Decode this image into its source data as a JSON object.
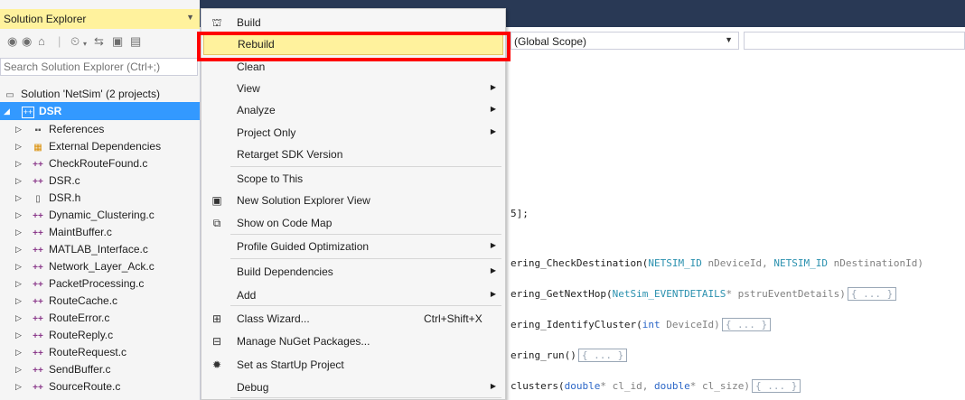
{
  "solution_explorer": {
    "title": "Solution Explorer",
    "search_placeholder": "Search Solution Explorer (Ctrl+;)",
    "solution_label": "Solution 'NetSim' (2 projects)",
    "project_label": "DSR",
    "items": [
      {
        "label": "References",
        "icon": "references-icon"
      },
      {
        "label": "External Dependencies",
        "icon": "external-dependencies-icon"
      },
      {
        "label": "CheckRouteFound.c",
        "icon": "c-file-icon"
      },
      {
        "label": "DSR.c",
        "icon": "c-file-icon"
      },
      {
        "label": "DSR.h",
        "icon": "h-file-icon"
      },
      {
        "label": "Dynamic_Clustering.c",
        "icon": "c-file-icon"
      },
      {
        "label": "MaintBuffer.c",
        "icon": "c-file-icon"
      },
      {
        "label": "MATLAB_Interface.c",
        "icon": "c-file-icon"
      },
      {
        "label": "Network_Layer_Ack.c",
        "icon": "c-file-icon"
      },
      {
        "label": "PacketProcessing.c",
        "icon": "c-file-icon"
      },
      {
        "label": "RouteCache.c",
        "icon": "c-file-icon"
      },
      {
        "label": "RouteError.c",
        "icon": "c-file-icon"
      },
      {
        "label": "RouteReply.c",
        "icon": "c-file-icon"
      },
      {
        "label": "RouteRequest.c",
        "icon": "c-file-icon"
      },
      {
        "label": "SendBuffer.c",
        "icon": "c-file-icon"
      },
      {
        "label": "SourceRoute.c",
        "icon": "c-file-icon"
      }
    ]
  },
  "editor": {
    "scope": "(Global Scope)",
    "lines": [
      {
        "text": "5];"
      },
      {
        "pre": "ering_CheckDestination(",
        "t1": "NETSIM_ID",
        "a1": " nDeviceId, ",
        "t2": "NETSIM_ID",
        "a2": " nDestinationId)"
      },
      {
        "pre": "ering_GetNextHop(",
        "t1": "NetSim_EVENTDETAILS",
        "a1": "* pstruEventDetails)",
        "fold": "{ ... }"
      },
      {
        "pre": "ering_IdentifyCluster(",
        "t1": "int",
        "a1": " DeviceId)",
        "fold": "{ ... }"
      },
      {
        "pre": "ering_run()",
        "fold": "{ ... }"
      },
      {
        "pre": "clusters(",
        "t1": "double",
        "a1": "* cl_id, ",
        "t2": "double",
        "a2": "* cl_size)",
        "fold": "{ ... }"
      }
    ]
  },
  "context_menu": {
    "items": [
      {
        "label": "Build",
        "icon": "build-icon"
      },
      {
        "label": "Rebuild",
        "highlighted": true
      },
      {
        "label": "Clean"
      },
      {
        "label": "View",
        "submenu": true
      },
      {
        "label": "Analyze",
        "submenu": true
      },
      {
        "label": "Project Only",
        "submenu": true
      },
      {
        "label": "Retarget SDK Version"
      },
      {
        "label": "Scope to This"
      },
      {
        "label": "New Solution Explorer View",
        "icon": "new-view-icon"
      },
      {
        "label": "Show on Code Map",
        "icon": "code-map-icon"
      },
      {
        "label": "Profile Guided Optimization",
        "submenu": true
      },
      {
        "label": "Build Dependencies",
        "submenu": true
      },
      {
        "label": "Add",
        "submenu": true
      },
      {
        "label": "Class Wizard...",
        "shortcut": "Ctrl+Shift+X",
        "icon": "class-wizard-icon"
      },
      {
        "label": "Manage NuGet Packages...",
        "icon": "nuget-icon"
      },
      {
        "label": "Set as StartUp Project",
        "icon": "gear-icon"
      },
      {
        "label": "Debug",
        "submenu": true
      }
    ]
  },
  "colors": {
    "title_bar_highlight": "#fff29d",
    "selection": "#3399ff",
    "annotation_box": "#ff0000",
    "editor_header": "#293955"
  }
}
